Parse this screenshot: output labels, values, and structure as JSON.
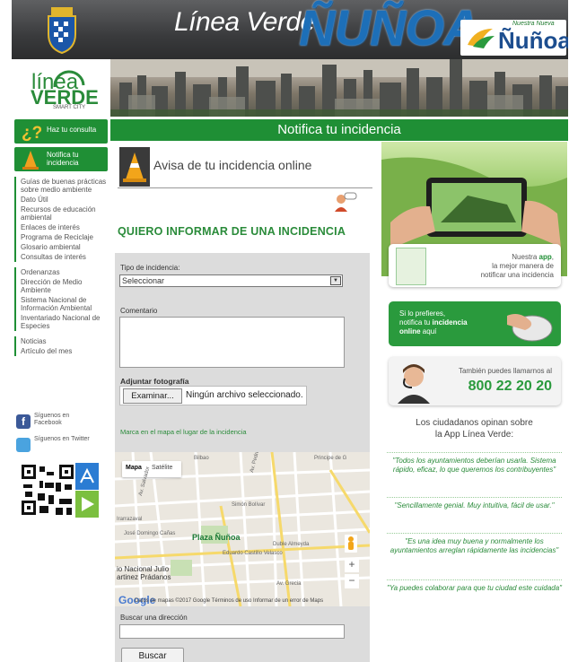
{
  "header": {
    "title_line": "Línea Verde",
    "title_nunoa": "ÑUÑOA",
    "logo_small": "Nuestra Nueva",
    "logo_big": "Ñuñoa"
  },
  "left_logo": {
    "line1": "línea",
    "line2": "VERDE",
    "line3": "SMART CITY"
  },
  "title_bar": "Notifica tu incidencia",
  "left_nav": {
    "consulta": "Haz tu consulta",
    "notifica": "Notifica tu incidencia",
    "groups": [
      [
        "Guías de buenas prácticas sobre medio ambiente",
        "Dato Útil",
        "Recursos de educación ambiental",
        "Enlaces de interés",
        "Programa de Reciclaje",
        "Glosario ambiental",
        "Consultas de interés"
      ],
      [
        "Ordenanzas",
        "Dirección de Medio Ambiente",
        "Sistema Nacional de Información Ambiental",
        "Inventariado Nacional de Especies"
      ],
      [
        "Noticias",
        "Artículo del mes"
      ]
    ],
    "facebook": "Síguenos en Facebook",
    "twitter": "Síguenos en Twitter"
  },
  "main": {
    "avisa": "Avisa de tu incidencia online",
    "heading": "QUIERO INFORMAR DE UNA INCIDENCIA",
    "tipo_label": "Tipo de incidencia:",
    "tipo_value": "Seleccionar",
    "comentario_label": "Comentario",
    "adjuntar_label": "Adjuntar fotografía",
    "file_button": "Examinar...",
    "file_text": "Ningún archivo seleccionado.",
    "marca": "Marca en el mapa el lugar de la incidencia",
    "buscar_label": "Buscar una dirección",
    "buscar_button": "Buscar"
  },
  "map": {
    "tab_map": "Mapa",
    "tab_sat": "Satélite",
    "plaza": "Plaza Ñuñoa",
    "place1": "io Nacional Julio",
    "place2": "artinez Prádanos",
    "google": "Google",
    "attrib": "Datos de mapas ©2017 Google   Términos de uso   Informar de un error de Maps",
    "streets": [
      "Simón Bolívar",
      "José Domingo Cañas",
      "Duble Almeyda",
      "Eduardo Castillo Velasco",
      "Av. Grecia",
      "Principe de G",
      "Irarrazaval",
      "Av. Pedro de Valdivia",
      "Av. Salvador",
      "Bilbao"
    ],
    "zoom_in": "+",
    "zoom_out": "−"
  },
  "right": {
    "app_line1": "Nuestra",
    "app_word": "app",
    "app_line2": "la mejor manera de",
    "app_line3": "notificar una incidencia",
    "online_l1": "Si lo prefieres,",
    "online_l2a": "notifica tu",
    "online_l2b": "incidencia",
    "online_l3a": "online",
    "online_l3b": "aquí",
    "phone_small": "También puedes llamarnos al",
    "phone_number": "800 22 20 20",
    "opinan_l1": "Los ciudadanos opinan sobre",
    "opinan_l2": "la App Línea Verde:",
    "quotes": [
      "\"Todos los ayuntamientos deberían usarla. Sistema rápido, eficaz, lo que queremos los contribuyentes\"",
      "\"Sencillamente genial. Muy intuitiva, fácil de usar.\"",
      "\"Es una idea muy buena y normalmente los ayuntamientos arreglan rápidamente las incidencias\"",
      "\"Ya puedes colaborar para que tu ciudad este cuidada\""
    ]
  },
  "colors": {
    "green": "#1f8f35",
    "blue": "#1d6fb8"
  }
}
